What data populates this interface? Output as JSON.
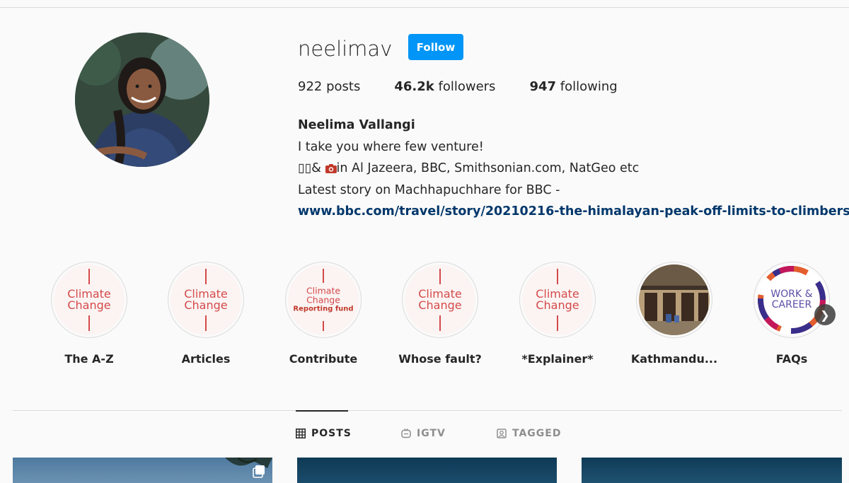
{
  "profile": {
    "username": "neelimav",
    "follow_label": "Follow",
    "stats": {
      "posts_num": "922",
      "posts_label": "posts",
      "followers_num": "46.2k",
      "followers_label": "followers",
      "following_num": "947",
      "following_label": "following"
    },
    "bio": {
      "full_name": "Neelima Vallangi",
      "line1": "I take you where few venture!",
      "line2_prefix": "▯▯&",
      "line2_suffix": "in Al Jazeera, BBC, Smithsonian.com, NatGeo etc",
      "line3": "Latest story on Machhapuchhare for BBC -",
      "link": "www.bbc.com/travel/story/20210216-the-himalayan-peak-off-limits-to-climbers"
    }
  },
  "highlights": [
    {
      "label": "The A-Z",
      "cover_line1": "Climate",
      "cover_line2": "Change"
    },
    {
      "label": "Articles",
      "cover_line1": "Climate",
      "cover_line2": "Change"
    },
    {
      "label": "Contribute",
      "cover_line1": "Climate",
      "cover_line2": "Change",
      "cover_line3": "Reporting fund"
    },
    {
      "label": "Whose fault?",
      "cover_line1": "Climate",
      "cover_line2": "Change"
    },
    {
      "label": "*Explainer*",
      "cover_line1": "Climate",
      "cover_line2": "Change"
    },
    {
      "label": "Kathmandu...",
      "cover_icon": "building-photo"
    },
    {
      "label": "FAQs",
      "cover_line1": "WORK &",
      "cover_line2": "CAREER"
    }
  ],
  "tabs": {
    "posts": "POSTS",
    "igtv": "IGTV",
    "tagged": "TAGGED"
  },
  "colors": {
    "follow_blue": "#0095f6",
    "link_blue": "#00376b",
    "climate_red": "#d44a4a"
  },
  "icons": {
    "camera": "camera-icon",
    "grid": "grid-icon",
    "igtv": "igtv-icon",
    "tagged": "tagged-icon",
    "next": "chevron-right-icon",
    "multi": "multiple-posts-icon"
  }
}
